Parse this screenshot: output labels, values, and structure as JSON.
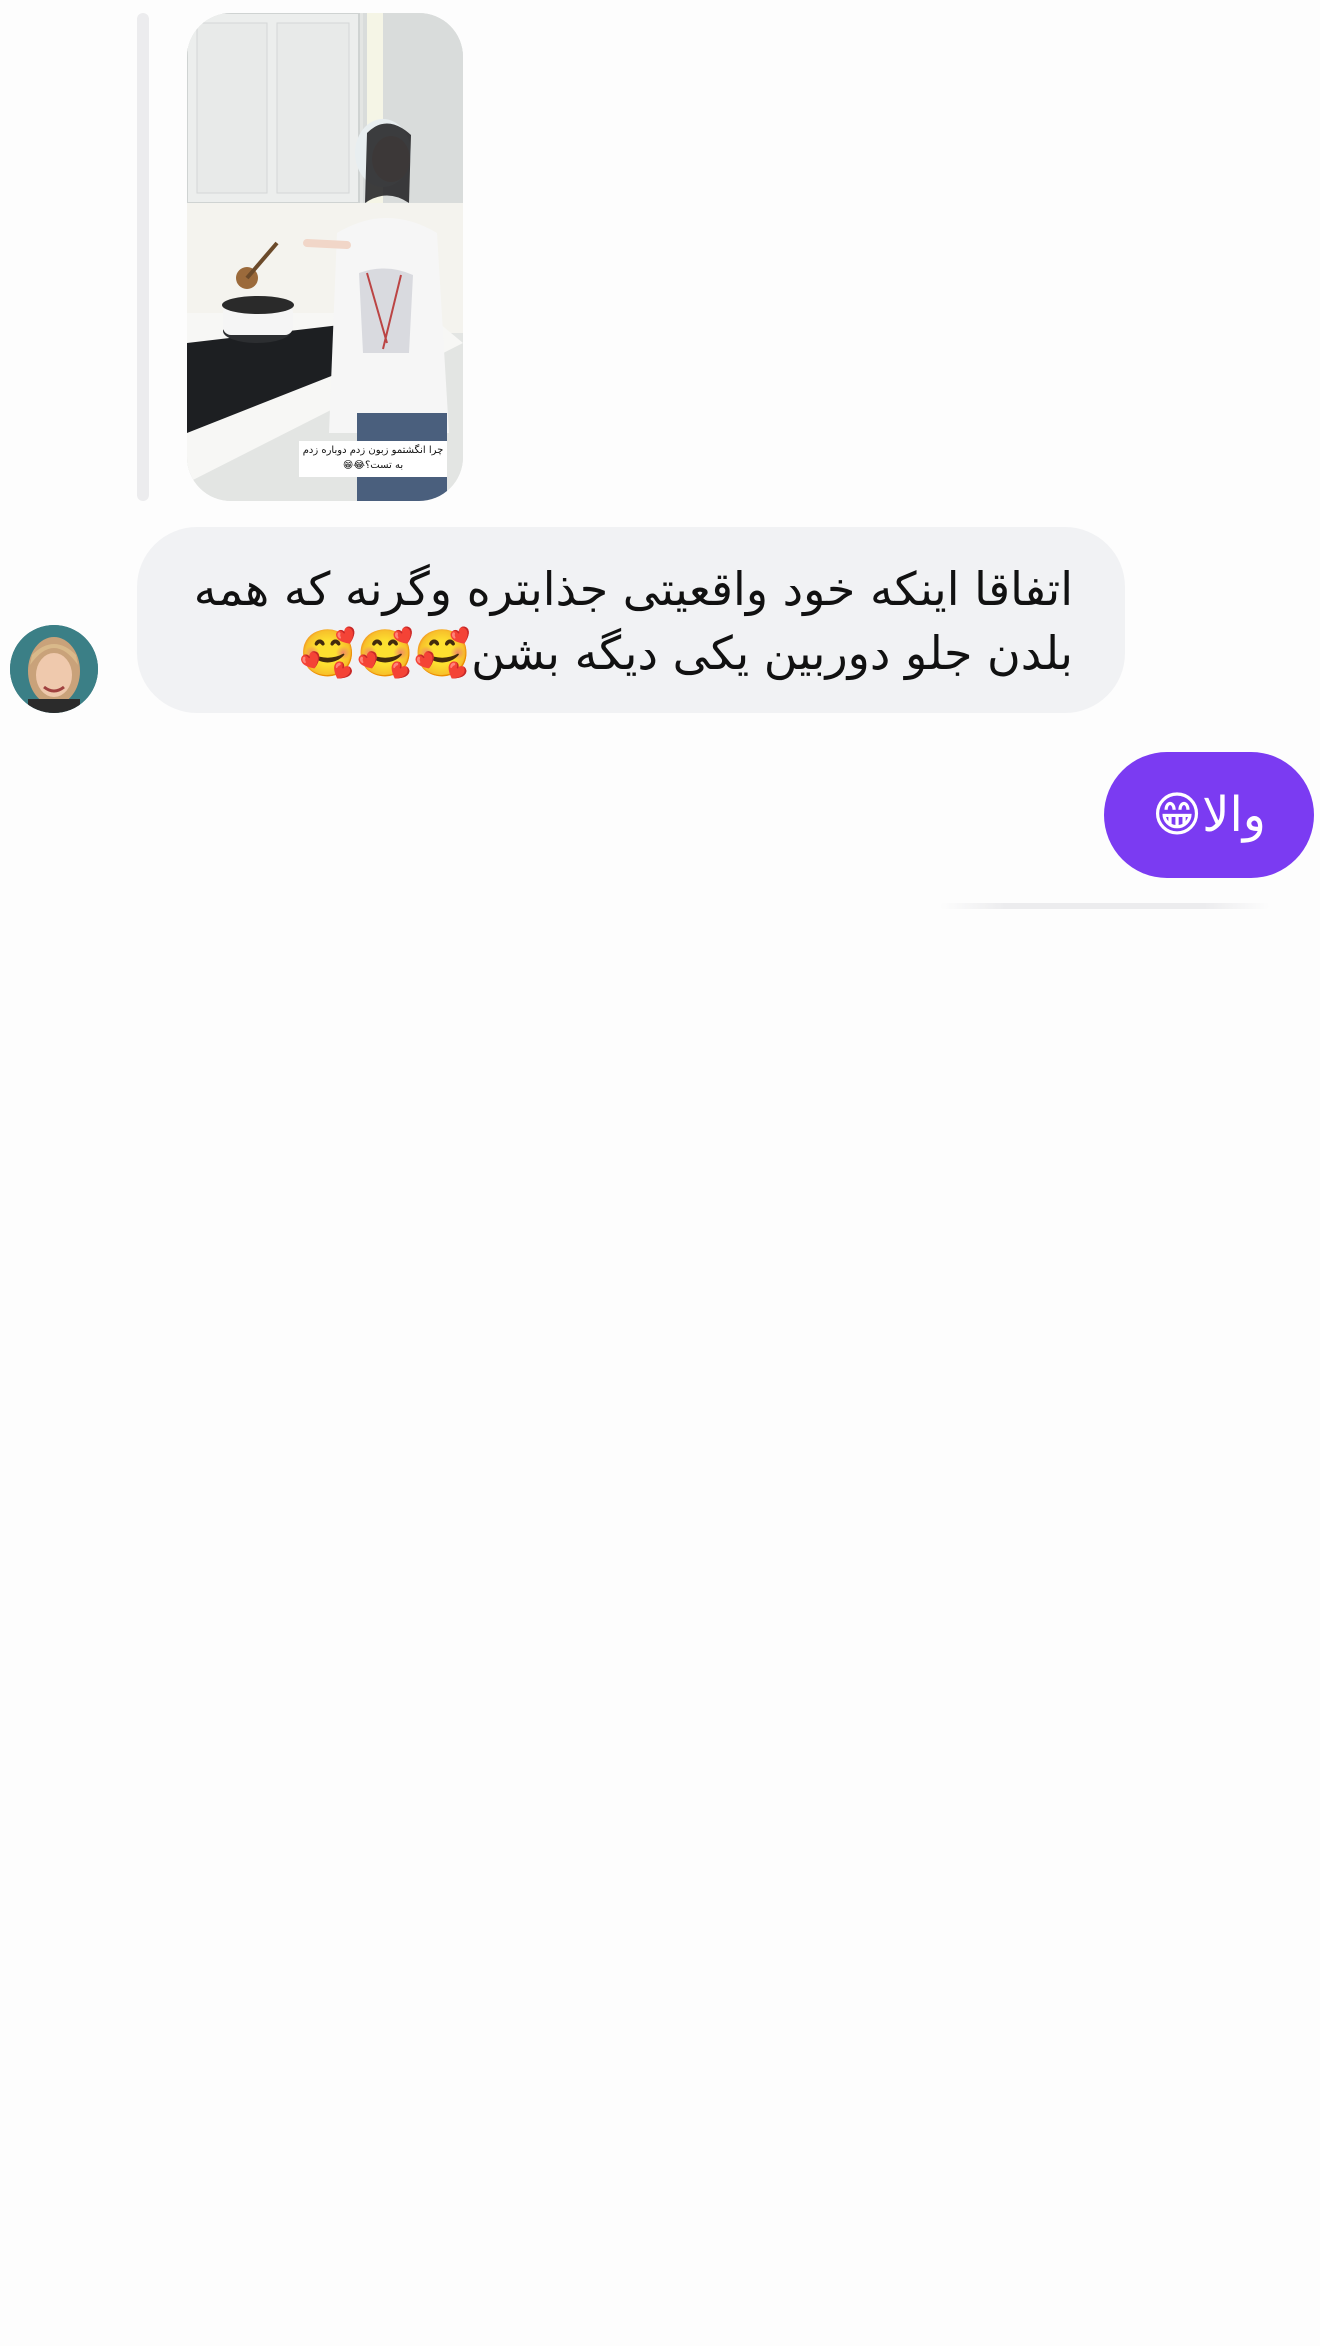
{
  "thread": {
    "shared_media": {
      "caption": "چرا انگشتمو زبون زدم دوباره زدم به تست؟😂😁",
      "icon": "shared-reel-thumbnail"
    },
    "incoming_message": {
      "line1": "اتفاقا اینکه خود واقعیتی جذابتره وگرنه که همه",
      "line2": "بلدن جلو دوربین یکی دیگه بشن🥰🥰🥰"
    },
    "outgoing_message": {
      "text": "والا😁"
    }
  },
  "colors": {
    "incoming_bubble": "#f1f2f4",
    "outgoing_bubble": "#7b3bf2",
    "reply_bar": "#ececee",
    "background": "#fdfdfd"
  }
}
